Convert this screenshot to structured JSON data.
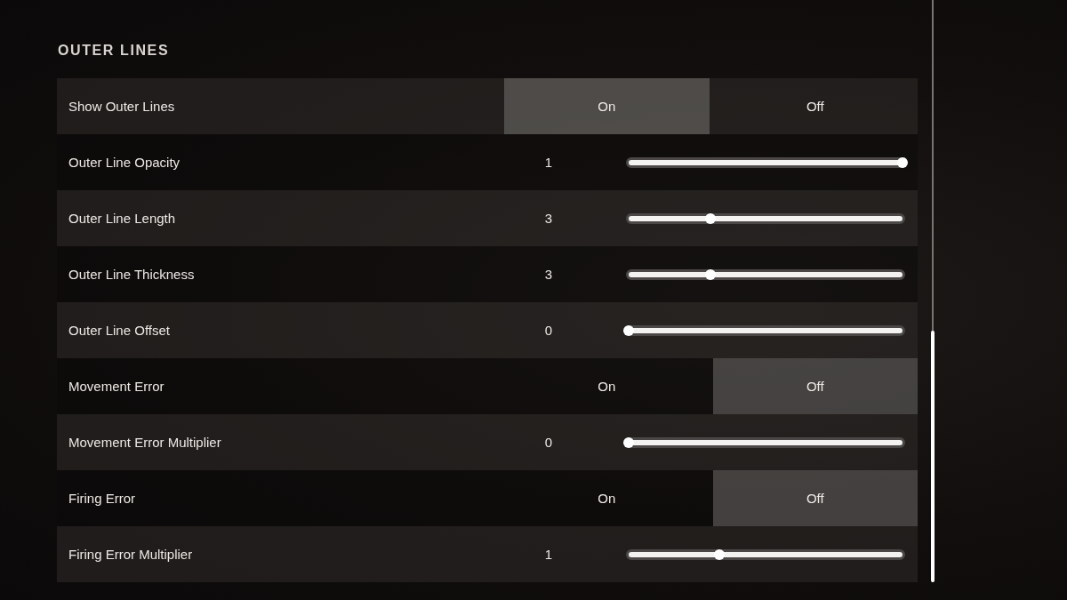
{
  "section": {
    "title": "OUTER LINES"
  },
  "settings": [
    {
      "kind": "toggle",
      "label": "Show Outer Lines",
      "options": [
        {
          "label": "On",
          "selected": true
        },
        {
          "label": "Off",
          "selected": false
        }
      ]
    },
    {
      "kind": "slider",
      "label": "Outer Line Opacity",
      "value": "1",
      "level": 1
    },
    {
      "kind": "slider",
      "label": "Outer Line Length",
      "value": "3",
      "level": 0.3
    },
    {
      "kind": "slider",
      "label": "Outer Line Thickness",
      "value": "3",
      "level": 0.3
    },
    {
      "kind": "slider",
      "label": "Outer Line Offset",
      "value": "0",
      "level": 0
    },
    {
      "kind": "toggle",
      "label": "Movement Error",
      "options": [
        {
          "label": "On",
          "selected": false
        },
        {
          "label": "Off",
          "selected": true
        }
      ]
    },
    {
      "kind": "slider",
      "label": "Movement Error Multiplier",
      "value": "0",
      "level": 0
    },
    {
      "kind": "toggle",
      "label": "Firing Error",
      "options": [
        {
          "label": "On",
          "selected": false
        },
        {
          "label": "Off",
          "selected": true
        }
      ]
    },
    {
      "kind": "slider",
      "label": "Firing Error Multiplier",
      "value": "1",
      "level": 0.33
    }
  ]
}
